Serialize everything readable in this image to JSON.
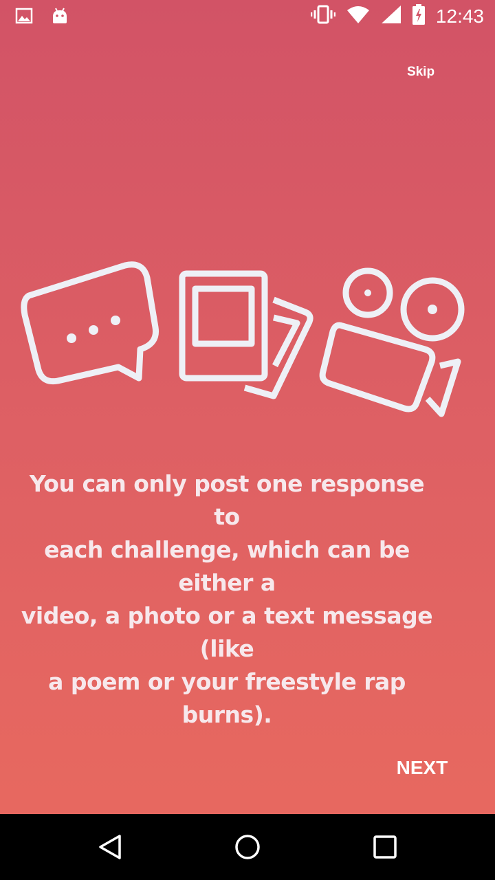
{
  "status_bar": {
    "time": "12:43",
    "icons_left": [
      "image-icon",
      "android-icon"
    ],
    "icons_right": [
      "vibrate-icon",
      "wifi-icon",
      "signal-icon",
      "battery-charging-icon"
    ]
  },
  "header": {
    "skip_label": "Skip"
  },
  "illustration": {
    "icons": [
      "chat-bubble-icon",
      "photo-stack-icon",
      "video-camera-icon"
    ],
    "stroke_color": "#eef0f6"
  },
  "body": {
    "message_line1": "You can only post one response to",
    "message_line2": "each challenge, which can be either a",
    "message_line3": "video, a photo or a text message (like",
    "message_line4": "a poem or your freestyle rap burns)."
  },
  "footer": {
    "next_label": "NEXT"
  },
  "colors": {
    "gradient_top": "#d25366",
    "gradient_bottom": "#e96a5f",
    "text": "#ffffff",
    "nav_bar": "#000000"
  },
  "nav_bar": {
    "buttons": [
      "back-icon",
      "home-icon",
      "recents-icon"
    ]
  }
}
